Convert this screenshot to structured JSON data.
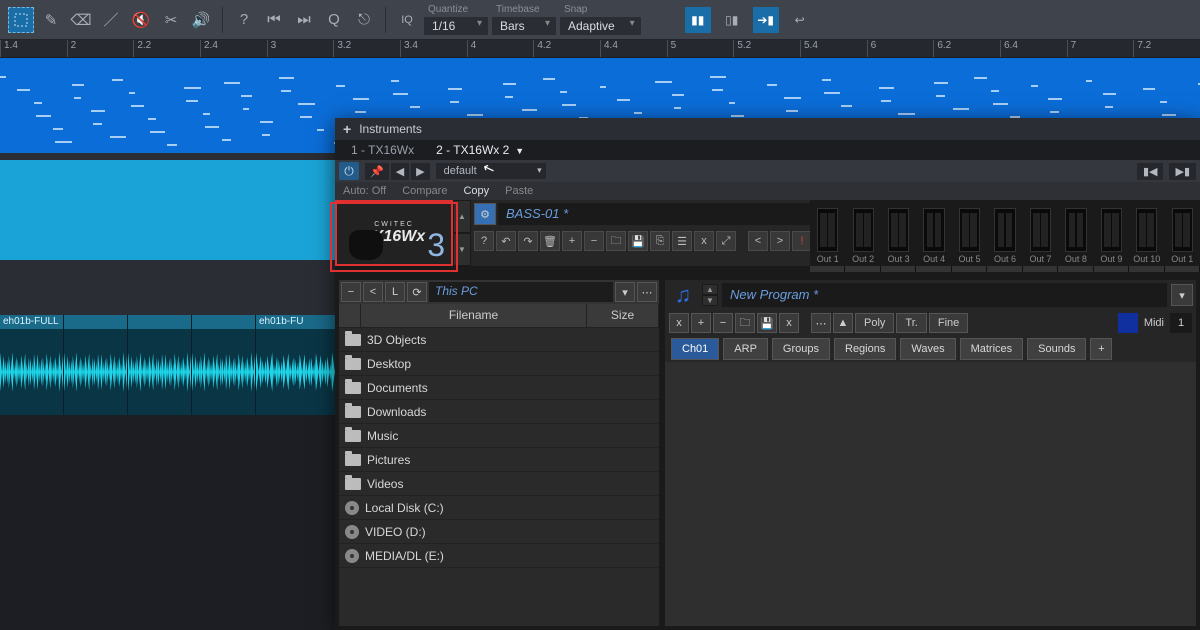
{
  "topbar": {
    "quantize_label": "Quantize",
    "quantize_value": "1/16",
    "timebase_label": "Timebase",
    "timebase_value": "Bars",
    "snap_label": "Snap",
    "snap_value": "Adaptive",
    "iq_label": "IQ"
  },
  "ruler": {
    "marks": [
      "1.4",
      "2",
      "2.2",
      "2.4",
      "3",
      "3.2",
      "3.4",
      "4",
      "4.2",
      "4.4",
      "5",
      "5.2",
      "5.4",
      "6",
      "6.2",
      "6.4",
      "7",
      "7.2"
    ]
  },
  "clips": [
    {
      "label": "eh01b-FULL"
    },
    {
      "label": ""
    },
    {
      "label": ""
    },
    {
      "label": ""
    },
    {
      "label": "eh01b-FU"
    }
  ],
  "panel": {
    "title": "Instruments",
    "tabs": [
      {
        "label": "1 - TX16Wx",
        "active": false
      },
      {
        "label": "2 - TX16Wx 2",
        "active": true
      }
    ],
    "preset": "default",
    "subbar": {
      "auto": "Auto: Off",
      "compare": "Compare",
      "copy": "Copy",
      "paste": "Paste"
    }
  },
  "plugin": {
    "logo_top": "CWITEC",
    "logo_name": "TX16Wx",
    "logo_num": "3",
    "preset_name": "BASS-01 *",
    "outputs": [
      "Out 1",
      "Out 2",
      "Out 3",
      "Out 4",
      "Out 5",
      "Out 6",
      "Out 7",
      "Out 8",
      "Out 9",
      "Out 10",
      "Out 1"
    ],
    "browser": {
      "path": "This PC",
      "col_name": "Filename",
      "col_size": "Size",
      "items": [
        {
          "icon": "folder",
          "label": "3D Objects"
        },
        {
          "icon": "folder",
          "label": "Desktop"
        },
        {
          "icon": "folder",
          "label": "Documents"
        },
        {
          "icon": "folder",
          "label": "Downloads"
        },
        {
          "icon": "folder",
          "label": "Music"
        },
        {
          "icon": "folder",
          "label": "Pictures"
        },
        {
          "icon": "folder",
          "label": "Videos"
        },
        {
          "icon": "disk",
          "label": "Local Disk (C:)"
        },
        {
          "icon": "disk",
          "label": "VIDEO (D:)"
        },
        {
          "icon": "disk",
          "label": "MEDIA/DL (E:)"
        }
      ]
    },
    "program": {
      "name": "New Program *",
      "poly": "Poly",
      "tr": "Tr.",
      "fine": "Fine",
      "midi_label": "Midi",
      "midi_ch": "1",
      "tabs": [
        "Ch01",
        "ARP",
        "Groups",
        "Regions",
        "Waves",
        "Matrices",
        "Sounds"
      ]
    }
  }
}
